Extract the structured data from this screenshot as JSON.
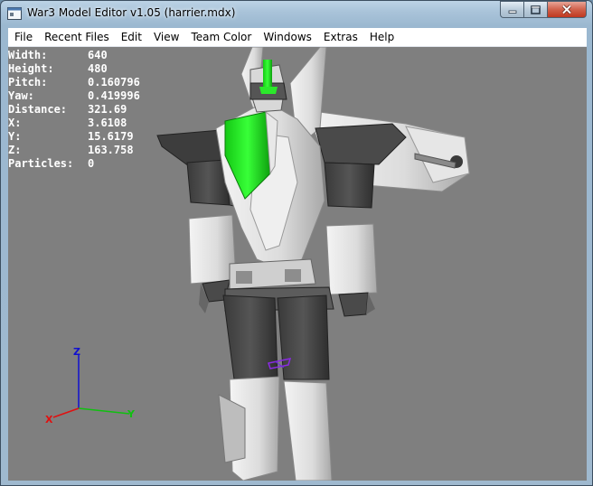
{
  "window": {
    "title": "War3 Model Editor v1.05 (harrier.mdx)"
  },
  "titlebar_buttons": [
    {
      "name": "minimize",
      "icon": "minimize-icon"
    },
    {
      "name": "maximize",
      "icon": "maximize-icon"
    },
    {
      "name": "close",
      "icon": "close-icon"
    }
  ],
  "menu": [
    {
      "label": "File"
    },
    {
      "label": "Recent Files"
    },
    {
      "label": "Edit"
    },
    {
      "label": "View"
    },
    {
      "label": "Team Color"
    },
    {
      "label": "Windows"
    },
    {
      "label": "Extras"
    },
    {
      "label": "Help"
    }
  ],
  "stats": [
    {
      "label": "Width:",
      "value": "640"
    },
    {
      "label": "Height:",
      "value": "480"
    },
    {
      "label": "Pitch:",
      "value": "0.160796"
    },
    {
      "label": "Yaw:",
      "value": "0.419996"
    },
    {
      "label": "Distance:",
      "value": "321.69"
    },
    {
      "label": "X:",
      "value": "3.6108"
    },
    {
      "label": "Y:",
      "value": "15.6179"
    },
    {
      "label": "Z:",
      "value": "163.758"
    },
    {
      "label": "Particles:",
      "value": "0"
    }
  ],
  "axes": {
    "x": "X",
    "y": "Y",
    "z": "Z"
  },
  "colors": {
    "viewport_bg": "#7f7f7f",
    "axis_x": "#e01010",
    "axis_y": "#10c010",
    "axis_z": "#1010d0",
    "team_color": "#22ee22"
  }
}
